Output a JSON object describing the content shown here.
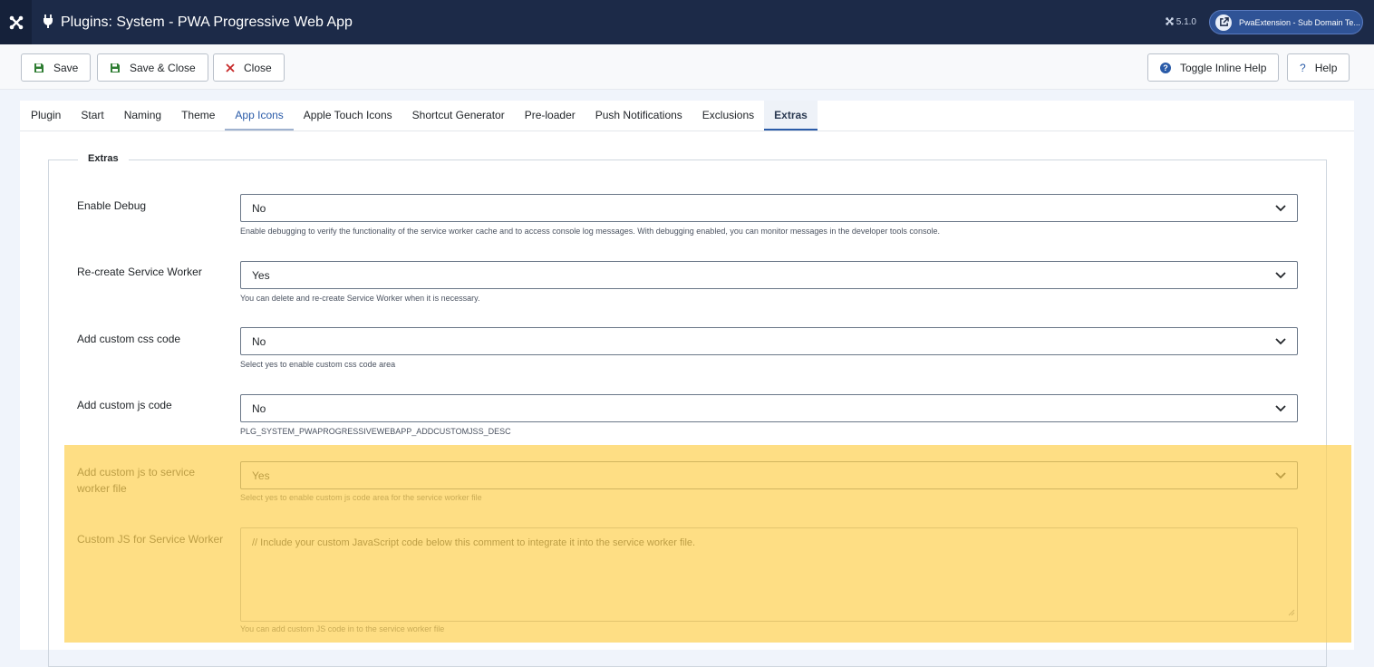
{
  "header": {
    "title": "Plugins: System - PWA Progressive Web App",
    "version": "5.1.0",
    "site_button": "PwaExtension - Sub Domain Te..."
  },
  "toolbar": {
    "save": "Save",
    "save_close": "Save & Close",
    "close": "Close",
    "toggle_help": "Toggle Inline Help",
    "help": "Help"
  },
  "tabs": [
    "Plugin",
    "Start",
    "Naming",
    "Theme",
    "App Icons",
    "Apple Touch Icons",
    "Shortcut Generator",
    "Pre-loader",
    "Push Notifications",
    "Exclusions",
    "Extras"
  ],
  "active_tab": "Extras",
  "section": {
    "legend": "Extras",
    "fields": [
      {
        "label": "Enable Debug",
        "value": "No",
        "desc": "Enable debugging to verify the functionality of the service worker cache and to access console log messages. With debugging enabled, you can monitor messages in the developer tools console."
      },
      {
        "label": "Re-create Service Worker",
        "value": "Yes",
        "desc": "You can delete and re-create Service Worker when it is necessary."
      },
      {
        "label": "Add custom css code",
        "value": "No",
        "desc": "Select yes to enable custom css code area"
      },
      {
        "label": "Add custom js code",
        "value": "No",
        "desc": "PLG_SYSTEM_PWAPROGRESSIVEWEBAPP_ADDCUSTOMJSS_DESC"
      },
      {
        "label": "Add custom js to service worker file",
        "value": "Yes",
        "desc": "Select yes to enable custom js code area for the service worker file"
      }
    ],
    "custom_js": {
      "label": "Custom JS for Service Worker",
      "value": "// Include your custom JavaScript code below this comment to integrate it into the service worker file.",
      "desc": "You can add custom JS code in to the service worker file"
    }
  },
  "colors": {
    "header_bg": "#1c2a48",
    "accent": "#2a5ba8",
    "highlight": "#fdd050",
    "save_icon": "#2e7d32",
    "close_icon": "#c62828"
  }
}
